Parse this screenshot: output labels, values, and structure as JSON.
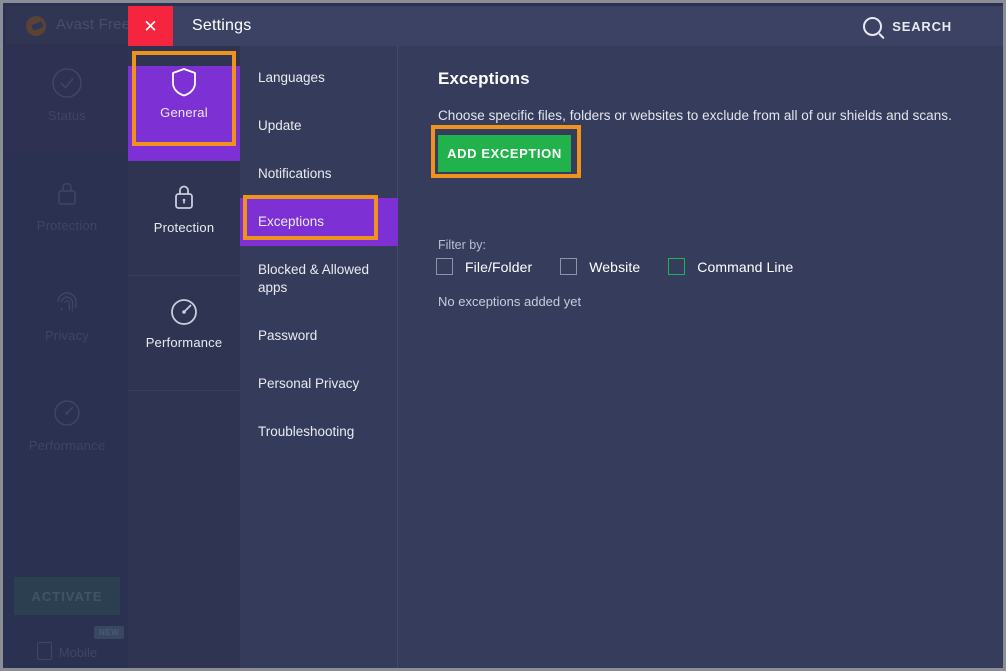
{
  "background_app": {
    "title": "Avast Free A",
    "logo_icon": "avast-logo-icon",
    "nav_items": [
      {
        "label": "Status",
        "icon": "check-circle-icon",
        "active": true
      },
      {
        "label": "Protection",
        "icon": "lock-icon",
        "active": false
      },
      {
        "label": "Privacy",
        "icon": "fingerprint-icon",
        "active": false
      },
      {
        "label": "Performance",
        "icon": "speedometer-icon",
        "active": false
      }
    ],
    "activate_label": "ACTIVATE",
    "new_badge": "NEW",
    "mobile_label": "Mobile",
    "mobile_icon": "mobile-device-icon"
  },
  "settings": {
    "header": {
      "title": "Settings",
      "close_icon": "close-icon",
      "close_label": "✕",
      "search_icon": "search-icon",
      "search_label": "SEARCH"
    },
    "categories": [
      {
        "label": "General",
        "icon": "shield-icon",
        "active": true
      },
      {
        "label": "Protection",
        "icon": "lock-icon",
        "active": false
      },
      {
        "label": "Performance",
        "icon": "speedometer-icon",
        "active": false
      }
    ],
    "submenu": [
      {
        "label": "Languages",
        "active": false
      },
      {
        "label": "Update",
        "active": false
      },
      {
        "label": "Notifications",
        "active": false
      },
      {
        "label": "Exceptions",
        "active": true
      },
      {
        "label": "Blocked & Allowed apps",
        "active": false
      },
      {
        "label": "Password",
        "active": false
      },
      {
        "label": "Personal Privacy",
        "active": false
      },
      {
        "label": "Troubleshooting",
        "active": false
      }
    ],
    "pane": {
      "title": "Exceptions",
      "description": "Choose specific files, folders or websites to exclude from all of our shields and scans.",
      "add_button_label": "ADD EXCEPTION",
      "filter_label": "Filter by:",
      "filters": [
        {
          "label": "File/Folder",
          "checked": false,
          "highlighted": false
        },
        {
          "label": "Website",
          "checked": false,
          "highlighted": false
        },
        {
          "label": "Command Line",
          "checked": false,
          "highlighted": true
        }
      ],
      "empty_state": "No exceptions added yet"
    }
  },
  "annotations": {
    "color": "#f0921e",
    "targets": [
      "general-category",
      "exceptions-submenu-item",
      "add-exception-button"
    ]
  },
  "colors": {
    "accent_purple": "#7d30d4",
    "green_button": "#22b24c",
    "close_red": "#f5253f",
    "panel_bg": "#363d5c",
    "submenu_bg": "#353c5b",
    "category_bg": "#2e3452",
    "header_bg": "#3b4263",
    "annotation_orange": "#f0921e"
  }
}
